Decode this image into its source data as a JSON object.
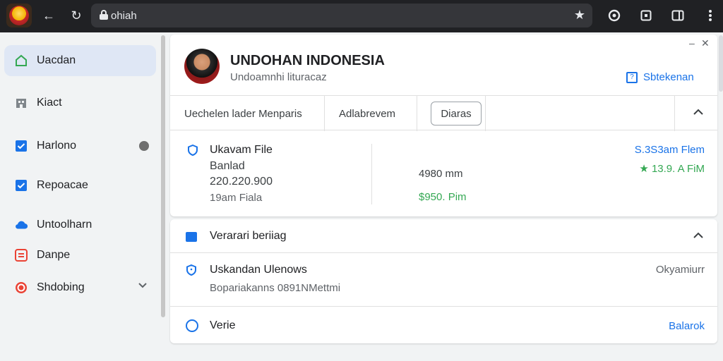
{
  "browser": {
    "url": "ohiah"
  },
  "sidebar": {
    "items": [
      {
        "label": "Uacdan",
        "active": true
      },
      {
        "label": "Kiact"
      },
      {
        "label": "Harlono",
        "status_dot": true
      },
      {
        "label": "Repoacae"
      },
      {
        "label": "Untoolharn"
      },
      {
        "label": "Danpe"
      },
      {
        "label": "Shdobing",
        "expandable": true
      }
    ]
  },
  "profile": {
    "title": "UNDOHAN INDONESIA",
    "subtitle": "Undoamnhi lituracaz",
    "action_link": "Sbtekenan"
  },
  "tabs": {
    "first": "Uechelen lader Menparis",
    "second": "Adlabrevem",
    "button": "Diaras"
  },
  "file": {
    "title": "Ukavam File",
    "line1": "Banlad",
    "line2": "220.220.900",
    "line3": "19am Fiala",
    "middle": "4980 mm",
    "green_value": "$950. Pim",
    "right_top": "S.3S3am Flem",
    "right_bottom": "13.9. A FiM"
  },
  "section": {
    "title": "Verarari beriiag",
    "item1": {
      "title": "Uskandan Ulenows",
      "subtitle": "Bopariakanns 0891NMettmi",
      "right": "Okyamiurr"
    },
    "item2": {
      "title": "Verie",
      "right": "Balarok"
    }
  },
  "colors": {
    "accent": "#1a73e8",
    "green": "#34a853",
    "topbar": "#202124"
  }
}
